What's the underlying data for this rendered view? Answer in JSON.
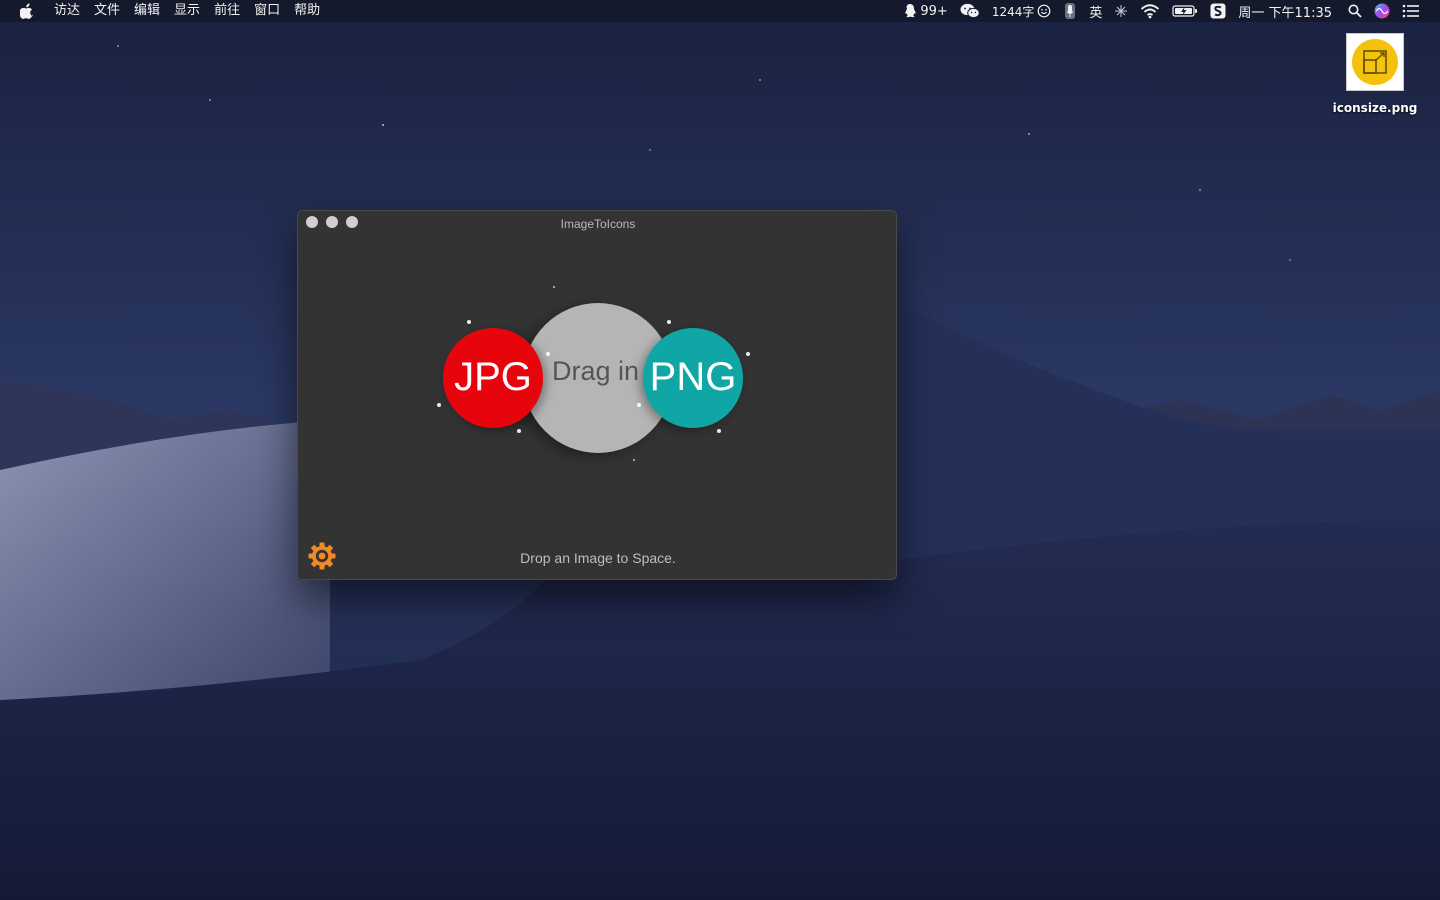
{
  "menubar": {
    "apple_icon": "apple-logo-icon",
    "items": [
      "访达",
      "文件",
      "编辑",
      "显示",
      "前往",
      "窗口",
      "帮助"
    ],
    "status": {
      "qq_count": "99+",
      "word_count": "1244字",
      "input_lang": "英",
      "clock": "周一 下午11:35"
    }
  },
  "desktop": {
    "icon_label": "iconsize.png",
    "thumb_color": "#f4c20d"
  },
  "window": {
    "title": "ImageToIcons",
    "jpg_label": "JPG",
    "drag_label": "Drag in",
    "png_label": "PNG",
    "hint": "Drop an Image to Space.",
    "colors": {
      "jpg": "#e8040c",
      "png": "#10a6a6",
      "center": "#b5b5b5",
      "gear": "#f08a24"
    }
  }
}
